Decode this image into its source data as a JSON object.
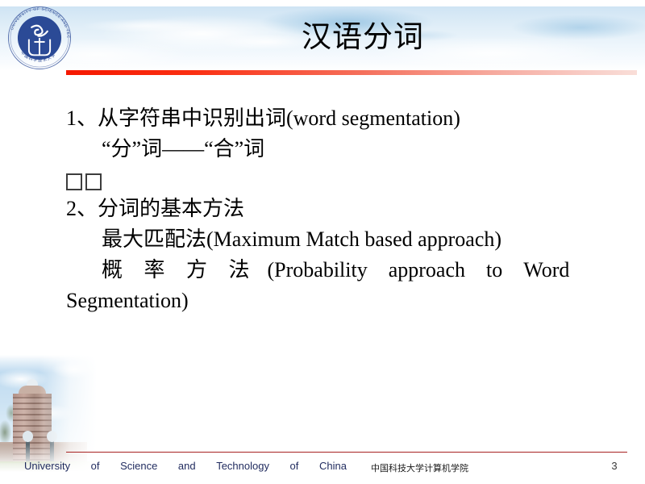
{
  "slide": {
    "title": "汉语分词",
    "page_number": "3",
    "accent_colors": {
      "header_rule_start": "#f51800",
      "header_rule_end": "#f9ded8",
      "footer_rule": "#a82222",
      "footer_text": "#1f2a5e",
      "logo_blue": "#2b4a96",
      "sky_blue": "#cfe4f4"
    }
  },
  "logo": {
    "ring_text_top": "UNIVERSITY OF SCIENCE AND TECHNOLOGY OF CHINA",
    "ring_text_bottom": "中国科学技术大学"
  },
  "body": {
    "item1_heading": "1、从字符串中识别出词(word segmentation)",
    "item1_sub": "“分”词——“合”词",
    "tofu_count": 2,
    "item2_heading": "2、分词的基本方法",
    "item2_sub1": "最大匹配法(Maximum Match based approach)",
    "item2_sub2_parts": {
      "cn": "概 率 方 法",
      "w1": "(Probability",
      "w2": "approach",
      "w3": "to",
      "w4": "Word",
      "w5": "Segmentation)"
    }
  },
  "footer": {
    "left_words": [
      "University",
      "of",
      "Science",
      "and",
      "Technology",
      "of",
      "China"
    ],
    "center": "中国科技大学计算机学院",
    "page": "3"
  }
}
